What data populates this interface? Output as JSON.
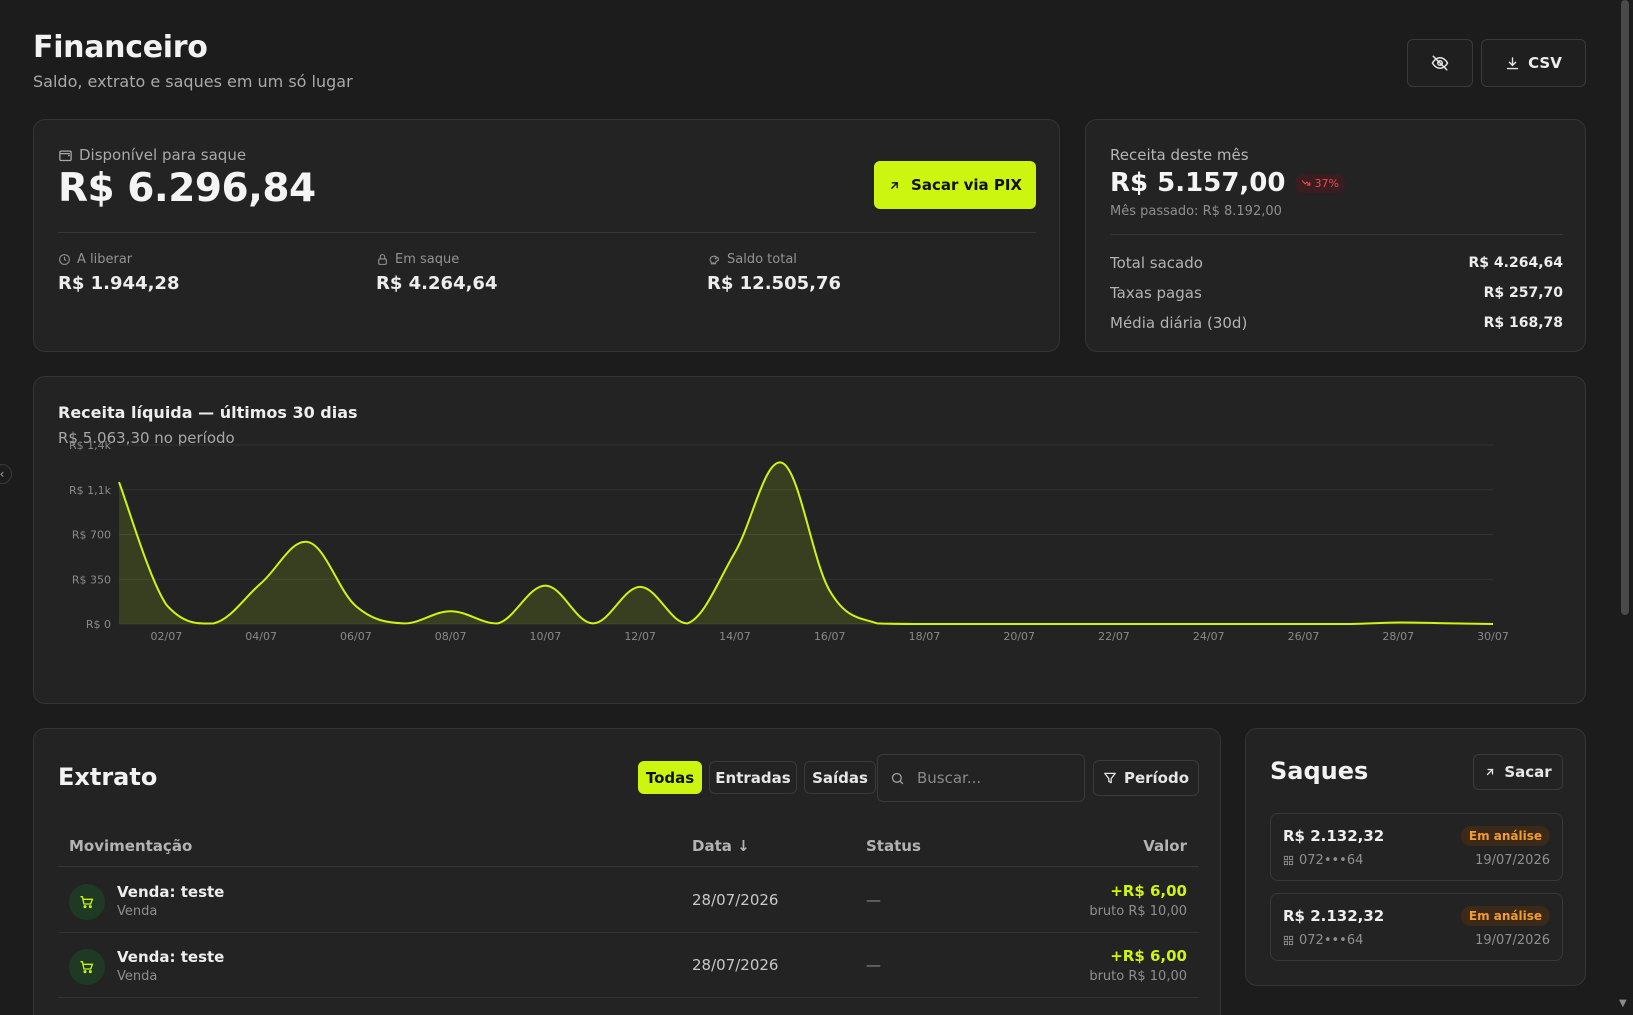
{
  "header": {
    "title": "Financeiro",
    "subtitle": "Saldo, extrato e saques em um só lugar",
    "csv_label": "CSV"
  },
  "balance": {
    "label": "Disponível para saque",
    "amount": "R$ 6.296,84",
    "withdraw_button": "Sacar via PIX",
    "stats": [
      {
        "label": "A liberar",
        "value": "R$ 1.944,28",
        "icon": "clock-icon"
      },
      {
        "label": "Em saque",
        "value": "R$ 4.264,64",
        "icon": "lock-icon"
      },
      {
        "label": "Saldo total",
        "value": "R$ 12.505,76",
        "icon": "piggy-bank-icon"
      }
    ]
  },
  "revenue": {
    "label": "Receita deste mês",
    "amount": "R$ 5.157,00",
    "change": "37%",
    "previous": "Mês passado: R$ 8.192,00",
    "rows": [
      {
        "label": "Total sacado",
        "value": "R$ 4.264,64"
      },
      {
        "label": "Taxas pagas",
        "value": "R$ 257,70"
      },
      {
        "label": "Média diária (30d)",
        "value": "R$ 168,78"
      }
    ]
  },
  "chart": {
    "title": "Receita líquida — últimos 30 dias",
    "subtitle": "R$ 5.063,30 no período"
  },
  "chart_data": {
    "type": "area",
    "title": "Receita líquida — últimos 30 dias",
    "y_ticks": [
      "R$ 0",
      "R$ 350",
      "R$ 700",
      "R$ 1,1k",
      "R$ 1,4k"
    ],
    "ylim": [
      0,
      1400
    ],
    "x_ticks": [
      "02/07",
      "04/07",
      "06/07",
      "08/07",
      "10/07",
      "12/07",
      "14/07",
      "16/07",
      "18/07",
      "20/07",
      "22/07",
      "24/07",
      "26/07",
      "28/07",
      "30/07"
    ],
    "x": [
      "01/07",
      "02/07",
      "03/07",
      "04/07",
      "05/07",
      "06/07",
      "07/07",
      "08/07",
      "09/07",
      "10/07",
      "11/07",
      "12/07",
      "13/07",
      "14/07",
      "15/07",
      "16/07",
      "17/07",
      "18/07",
      "19/07",
      "20/07",
      "21/07",
      "22/07",
      "23/07",
      "24/07",
      "25/07",
      "26/07",
      "27/07",
      "28/07",
      "29/07",
      "30/07"
    ],
    "values": [
      1110,
      150,
      5,
      320,
      640,
      140,
      5,
      100,
      5,
      300,
      5,
      290,
      5,
      560,
      1260,
      260,
      5,
      0,
      0,
      0,
      0,
      0,
      0,
      0,
      0,
      0,
      0,
      12,
      6,
      0
    ],
    "color": "#ccf50f",
    "grid": true
  },
  "extrato": {
    "title": "Extrato",
    "filters": [
      "Todas",
      "Entradas",
      "Saídas"
    ],
    "search_placeholder": "Buscar...",
    "period_label": "Período",
    "columns": [
      "Movimentação",
      "Data ↓",
      "Status",
      "Valor"
    ],
    "rows": [
      {
        "name": "Venda: teste",
        "kind": "Venda",
        "date": "28/07/2026",
        "status": "—",
        "value": "+R$ 6,00",
        "gross": "bruto R$ 10,00"
      },
      {
        "name": "Venda: teste",
        "kind": "Venda",
        "date": "28/07/2026",
        "status": "—",
        "value": "+R$ 6,00",
        "gross": "bruto R$ 10,00"
      }
    ]
  },
  "saques": {
    "title": "Saques",
    "button": "Sacar",
    "items": [
      {
        "amount": "R$ 2.132,32",
        "status": "Em análise",
        "key": "072•••64",
        "date": "19/07/2026"
      },
      {
        "amount": "R$ 2.132,32",
        "status": "Em análise",
        "key": "072•••64",
        "date": "19/07/2026"
      }
    ]
  }
}
